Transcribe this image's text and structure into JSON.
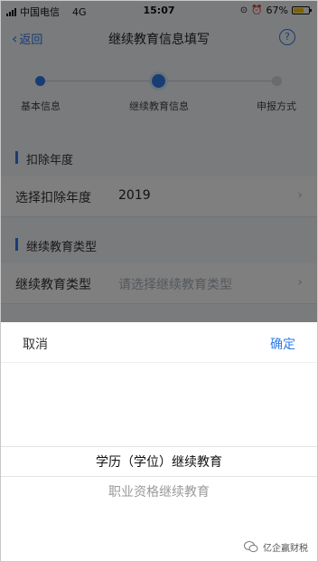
{
  "status_bar": {
    "carrier": "中国电信",
    "network": "4G",
    "time": "15:07",
    "battery_percent": "67%",
    "battery_level": 0.67,
    "battery_color": "#f5c518"
  },
  "nav": {
    "back_label": "返回",
    "title": "继续教育信息填写",
    "help_icon": "question-circle-icon",
    "accent": "#2f7be8"
  },
  "steps": [
    {
      "label": "基本信息",
      "state": "done"
    },
    {
      "label": "继续教育信息",
      "state": "active"
    },
    {
      "label": "申报方式",
      "state": "pending"
    }
  ],
  "sections": {
    "deduction_year": {
      "heading": "扣除年度",
      "row_label": "选择扣除年度",
      "row_value": "2019"
    },
    "education_type": {
      "heading": "继续教育类型",
      "row_label": "继续教育类型",
      "row_placeholder": "请选择继续教育类型"
    }
  },
  "picker": {
    "cancel_label": "取消",
    "confirm_label": "确定",
    "options": [
      "学历（学位）继续教育",
      "职业资格继续教育"
    ],
    "selected_index": 0
  },
  "watermark": {
    "text": "亿企赢财税",
    "icon": "wechat-icon"
  }
}
